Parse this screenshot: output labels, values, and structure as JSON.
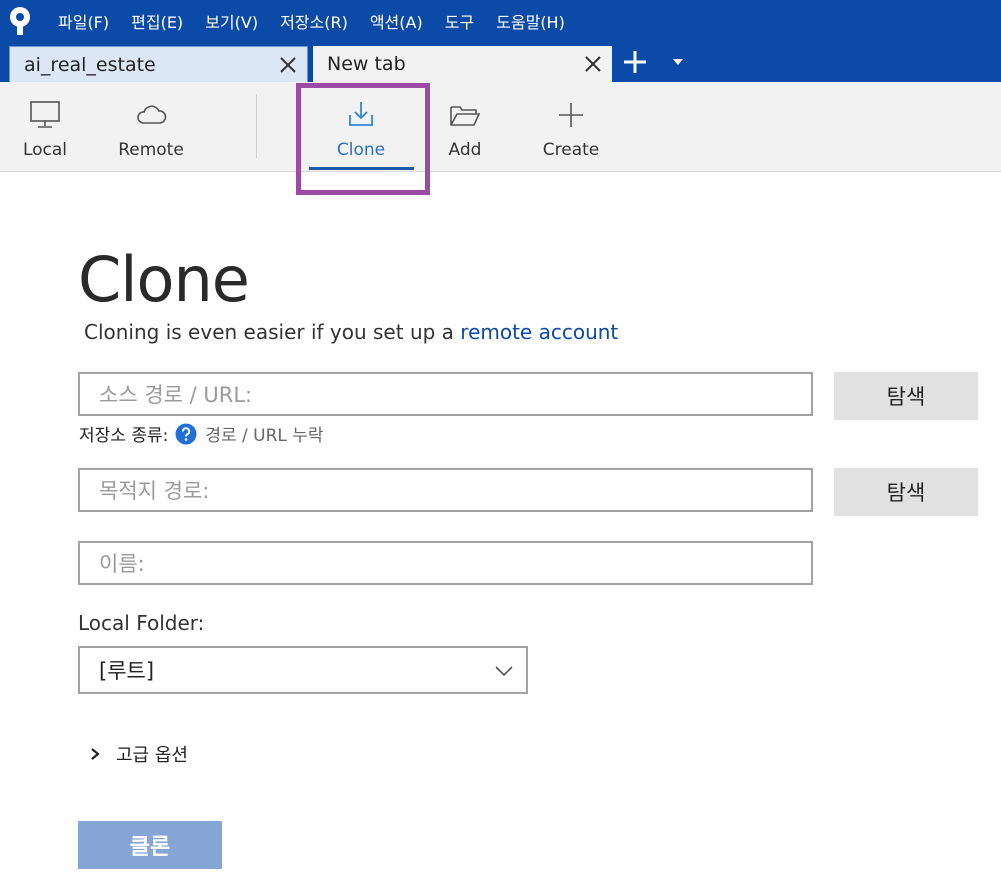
{
  "menu": {
    "items": [
      "파일(F)",
      "편집(E)",
      "보기(V)",
      "저장소(R)",
      "액션(A)",
      "도구",
      "도움말(H)"
    ]
  },
  "tabs": [
    {
      "label": "ai_real_estate",
      "state": "inactive"
    },
    {
      "label": "New tab",
      "state": "active"
    }
  ],
  "toolbar": {
    "local": "Local",
    "remote": "Remote",
    "clone": "Clone",
    "add": "Add",
    "create": "Create"
  },
  "clone_form": {
    "title": "Clone",
    "subtitle_prefix": "Cloning is even easier if you set up a ",
    "subtitle_link": "remote account",
    "source_placeholder": "소스 경로 / URL:",
    "browse_label": "탐색",
    "repo_type_label": "저장소 종류:",
    "repo_type_value": "경로 / URL 누락",
    "destination_placeholder": "목적지 경로:",
    "name_placeholder": "이름:",
    "local_folder_label": "Local Folder:",
    "local_folder_value": "[루트]",
    "advanced_options": "고급 옵션",
    "clone_button": "클론"
  },
  "colors": {
    "chrome_blue": "#0b4aa7",
    "highlight_purple": "#9b4ba3",
    "clone_button_bg": "#85a5d4",
    "link": "#0b4aa7"
  }
}
